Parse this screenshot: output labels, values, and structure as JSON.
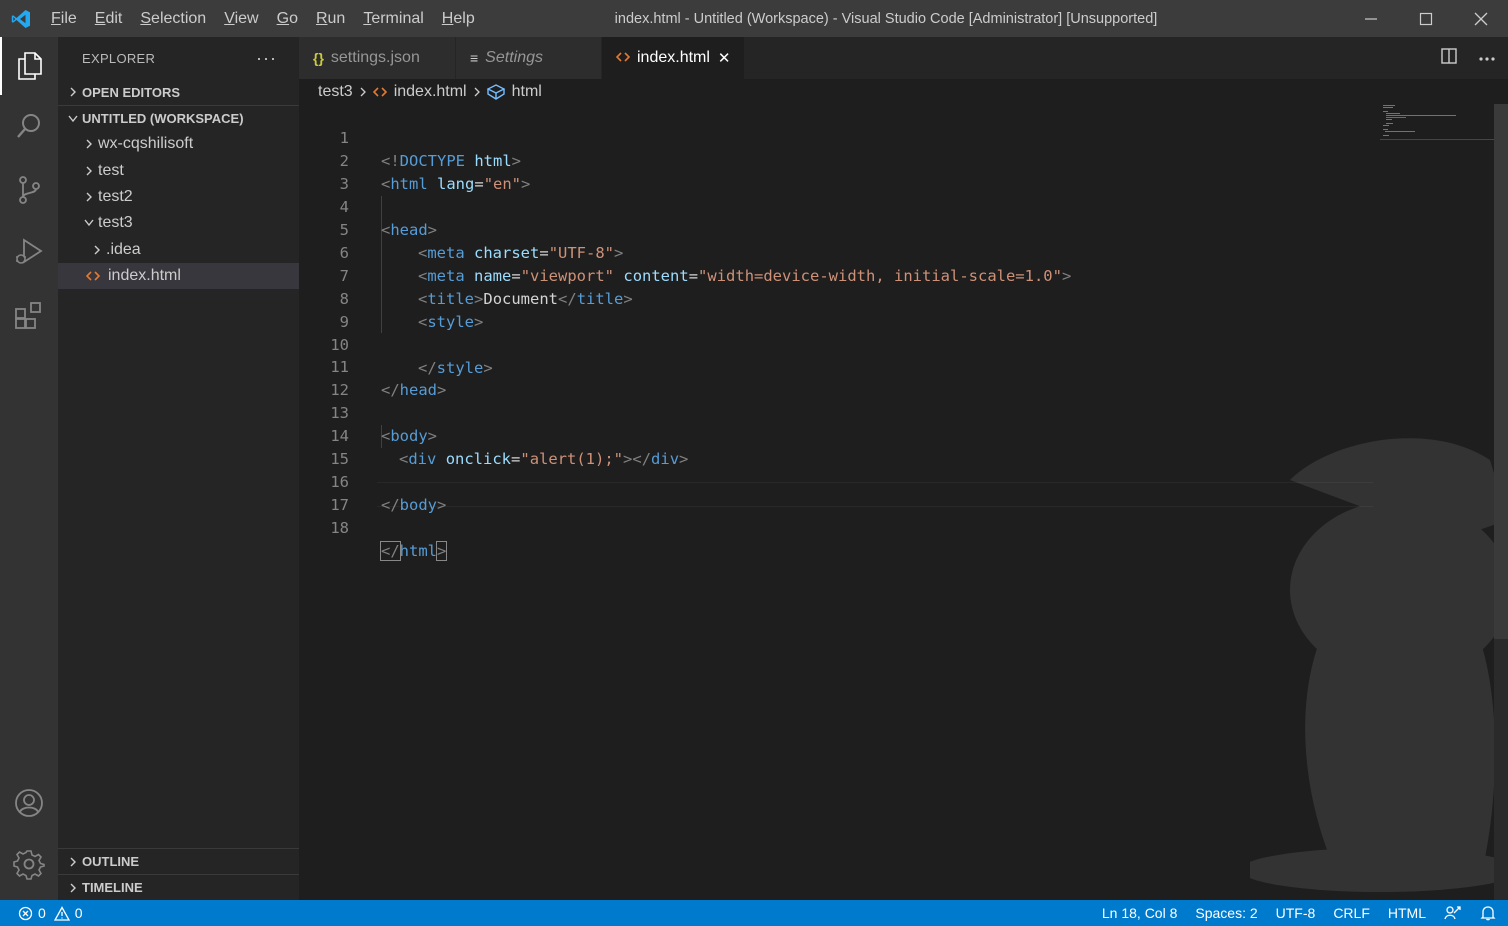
{
  "window": {
    "title": "index.html - Untitled (Workspace) - Visual Studio Code [Administrator] [Unsupported]",
    "menu": [
      {
        "mnemonic": "F",
        "rest": "ile"
      },
      {
        "mnemonic": "E",
        "rest": "dit"
      },
      {
        "mnemonic": "S",
        "rest": "election"
      },
      {
        "mnemonic": "V",
        "rest": "iew"
      },
      {
        "mnemonic": "G",
        "rest": "o"
      },
      {
        "mnemonic": "R",
        "rest": "un"
      },
      {
        "mnemonic": "T",
        "rest": "erminal"
      },
      {
        "mnemonic": "H",
        "rest": "elp"
      }
    ]
  },
  "sidebar": {
    "title": "EXPLORER",
    "more_label": "···",
    "open_editors": "OPEN EDITORS",
    "workspace": "UNTITLED (WORKSPACE)",
    "tree": {
      "wx": "wx-cqshilisoft",
      "test": "test",
      "test2": "test2",
      "test3": "test3",
      "idea": ".idea",
      "index": "index.html"
    },
    "outline": "OUTLINE",
    "timeline": "TIMELINE"
  },
  "tabs": {
    "settings_json": {
      "icon": "{}",
      "label": "settings.json"
    },
    "settings": {
      "icon": "≡",
      "label": "Settings"
    },
    "index": {
      "icon": "<>",
      "label": "index.html",
      "close": "✕"
    }
  },
  "breadcrumb": {
    "folder": "test3",
    "file": "index.html",
    "symbol": "html"
  },
  "code": {
    "line_numbers": [
      "1",
      "2",
      "3",
      "4",
      "5",
      "6",
      "7",
      "8",
      "9",
      "10",
      "11",
      "12",
      "13",
      "14",
      "15",
      "16",
      "17",
      "18"
    ],
    "l1": {
      "lt": "<!",
      "kw": "DOCTYPE",
      "sp": " ",
      "attr": "html",
      "gt": ">"
    },
    "l2": {
      "lt": "<",
      "tag": "html",
      "sp": " ",
      "attr": "lang",
      "eq": "=",
      "val": "\"en\"",
      "gt": ">"
    },
    "l4": {
      "lt": "<",
      "tag": "head",
      "gt": ">"
    },
    "l5": {
      "lt": "<",
      "tag": "meta",
      "sp": " ",
      "attr": "charset",
      "eq": "=",
      "val": "\"UTF-8\"",
      "gt": ">"
    },
    "l6": {
      "lt": "<",
      "tag": "meta",
      "sp": " ",
      "attr1": "name",
      "eq1": "=",
      "val1": "\"viewport\"",
      "sp2": " ",
      "attr2": "content",
      "eq2": "=",
      "val2": "\"width=device-width, initial-scale=1.0\"",
      "gt": ">"
    },
    "l7": {
      "lt": "<",
      "tag": "title",
      "gt": ">",
      "text": "Document",
      "lt2": "</",
      "tag2": "title",
      "gt2": ">"
    },
    "l8": {
      "lt": "<",
      "tag": "style",
      "gt": ">"
    },
    "l10": {
      "lt": "</",
      "tag": "style",
      "gt": ">"
    },
    "l11": {
      "lt": "</",
      "tag": "head",
      "gt": ">"
    },
    "l13": {
      "lt": "<",
      "tag": "body",
      "gt": ">"
    },
    "l14": {
      "lt": "<",
      "tag": "div",
      "sp": " ",
      "attr": "onclick",
      "eq": "=",
      "val": "\"alert(1);\"",
      "gt": ">",
      "lt2": "</",
      "tag2": "div",
      "gt2": ">"
    },
    "l16": {
      "lt": "</",
      "tag": "body",
      "gt": ">"
    },
    "l18": {
      "lt": "</",
      "tag": "html",
      "gt": ">"
    }
  },
  "status": {
    "errors": "0",
    "warnings": "0",
    "position": "Ln 18, Col 8",
    "spaces": "Spaces: 2",
    "encoding": "UTF-8",
    "eol": "CRLF",
    "language": "HTML"
  },
  "colors": {
    "accent": "#007acc",
    "tag": "#569cd6",
    "attribute": "#9cdcfe",
    "string": "#ce9178",
    "html_file_icon": "#e37933",
    "json_icon": "#cbcb41"
  },
  "icons": [
    "vscode-logo-icon",
    "files-icon",
    "search-icon",
    "source-control-icon",
    "run-debug-icon",
    "extensions-icon",
    "accounts-icon",
    "manage-gear-icon",
    "split-editor-icon",
    "more-actions-icon",
    "chevron-right-icon",
    "chevron-down-icon",
    "html-file-icon",
    "json-file-icon",
    "settings-file-icon",
    "close-icon",
    "symbol-element-icon",
    "error-icon",
    "warning-icon",
    "feedback-icon",
    "bell-icon",
    "minimize-icon",
    "maximize-icon",
    "window-close-icon"
  ]
}
